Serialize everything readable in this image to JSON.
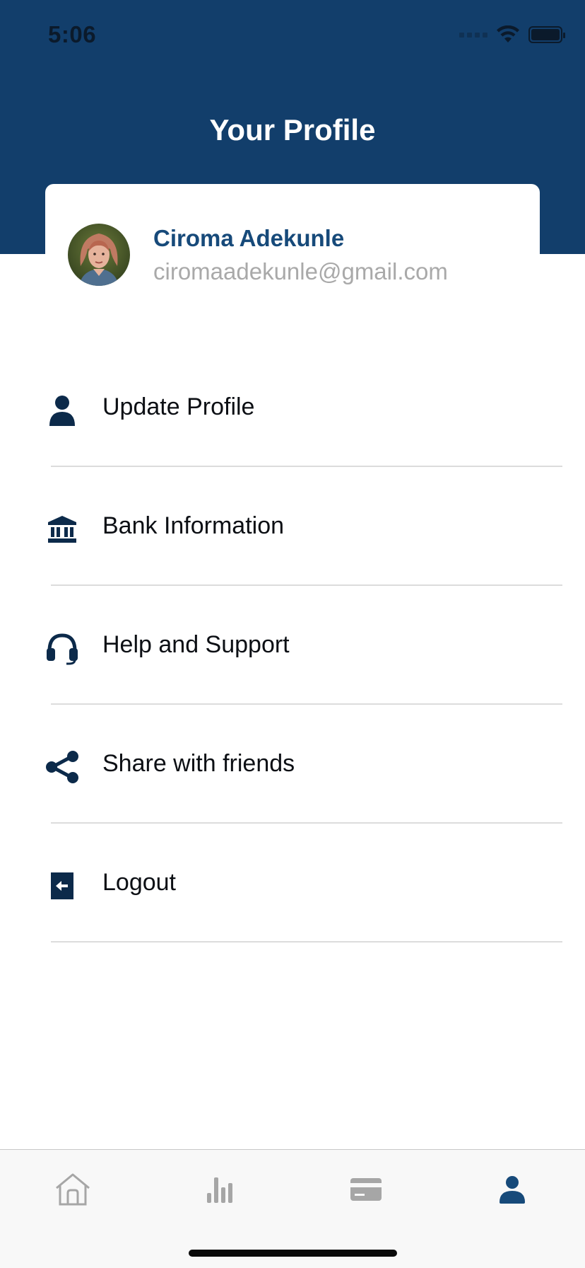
{
  "status_bar": {
    "time": "5:06"
  },
  "header": {
    "title": "Your Profile"
  },
  "profile": {
    "name": "Ciroma Adekunle",
    "email": "ciromaadekunle@gmail.com"
  },
  "menu": {
    "items": [
      {
        "label": "Update Profile",
        "icon": "person-icon"
      },
      {
        "label": "Bank Information",
        "icon": "bank-icon"
      },
      {
        "label": "Help and Support",
        "icon": "headset-icon"
      },
      {
        "label": "Share with friends",
        "icon": "share-icon"
      },
      {
        "label": "Logout",
        "icon": "logout-icon"
      }
    ]
  },
  "tab_bar": {
    "tabs": [
      {
        "icon": "home-icon",
        "active": false
      },
      {
        "icon": "bar-chart-icon",
        "active": false
      },
      {
        "icon": "card-icon",
        "active": false
      },
      {
        "icon": "profile-icon",
        "active": true
      }
    ]
  },
  "colors": {
    "primary": "#123e6b",
    "accent": "#174a7a",
    "muted": "#a9a9a9",
    "inactive_tab": "#a6a6a6"
  }
}
